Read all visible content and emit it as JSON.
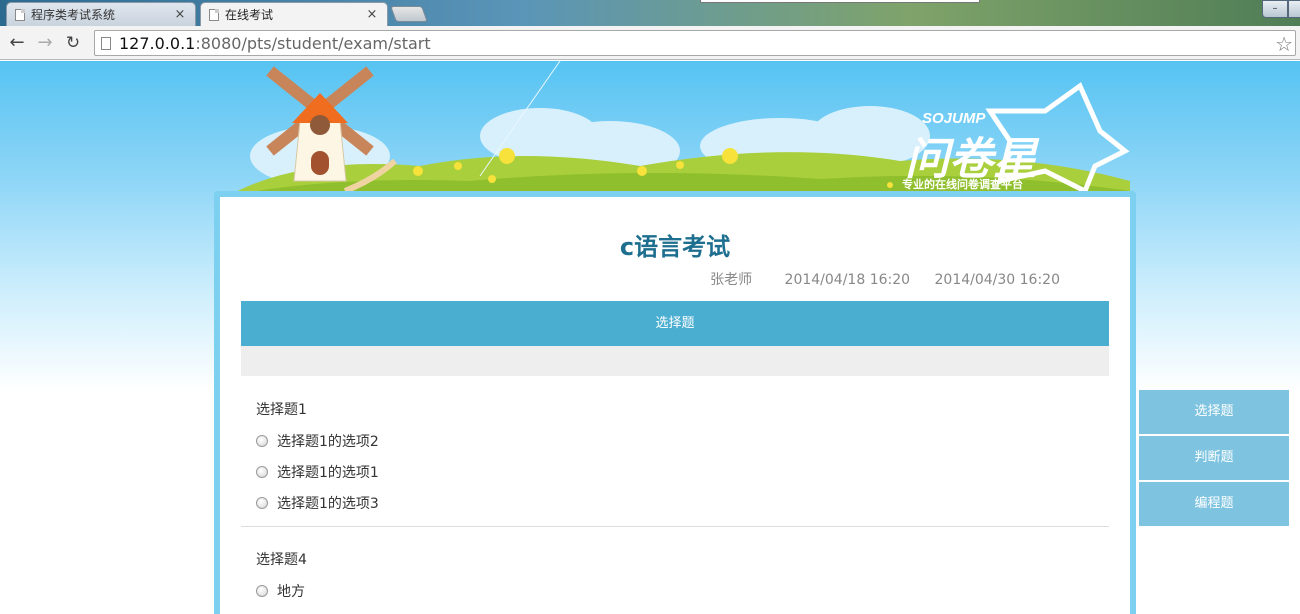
{
  "browser": {
    "tabs": [
      {
        "label": "程序类考试系统",
        "active": false
      },
      {
        "label": "在线考试",
        "active": true
      }
    ],
    "url_host": "127.0.0.1",
    "url_rest": ":8080/pts/student/exam/start"
  },
  "banner": {
    "brand_en": "SOJUMP",
    "brand_cn": "问卷星",
    "slogan": "专业的在线问卷调查平台"
  },
  "exam": {
    "title": "c语言考试",
    "teacher": "张老师",
    "start_time": "2014/04/18 16:20",
    "end_time": "2014/04/30 16:20",
    "section_title": "选择题"
  },
  "questions": [
    {
      "title": "选择题1",
      "options": [
        "选择题1的选项2",
        "选择题1的选项1",
        "选择题1的选项3"
      ]
    },
    {
      "title": "选择题4",
      "options": [
        "地方"
      ]
    }
  ],
  "side_nav": [
    "选择题",
    "判断题",
    "编程题"
  ],
  "colors": {
    "accent": "#4aaed0",
    "side_nav": "#7ec4e0",
    "title": "#1e6f8f",
    "frame": "#7dd0f0"
  }
}
